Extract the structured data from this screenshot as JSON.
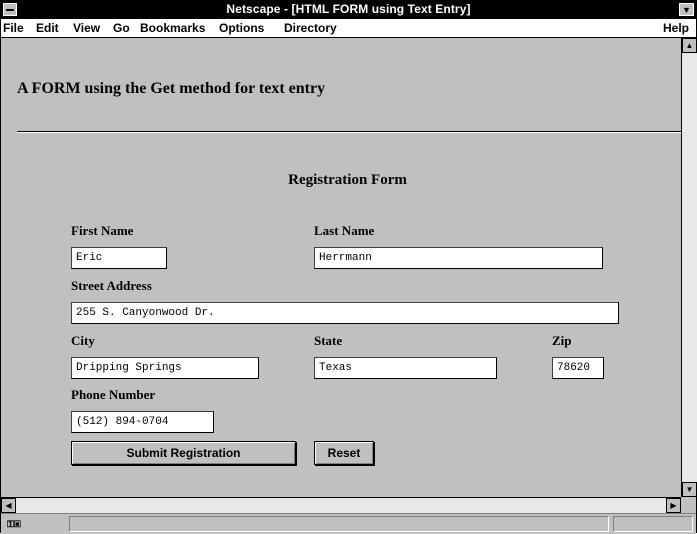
{
  "window": {
    "title": "Netscape - [HTML FORM using Text Entry]"
  },
  "menu": {
    "items": [
      {
        "label": "File"
      },
      {
        "label": "Edit"
      },
      {
        "label": "View"
      },
      {
        "label": "Go"
      },
      {
        "label": "Bookmarks"
      },
      {
        "label": "Options"
      },
      {
        "label": "Directory"
      },
      {
        "label": "Help"
      }
    ]
  },
  "page": {
    "heading": "A FORM using the Get method for text entry",
    "form_title": "Registration Form"
  },
  "form": {
    "first_name": {
      "label": "First Name",
      "value": "Eric"
    },
    "last_name": {
      "label": "Last Name",
      "value": "Herrmann"
    },
    "street": {
      "label": "Street Address",
      "value": "255 S. Canyonwood Dr."
    },
    "city": {
      "label": "City",
      "value": "Dripping Springs"
    },
    "state": {
      "label": "State",
      "value": "Texas"
    },
    "zip": {
      "label": "Zip",
      "value": "78620"
    },
    "phone": {
      "label": "Phone Number",
      "value": "(512) 894-0704"
    },
    "submit_label": "Submit Registration",
    "reset_label": "Reset"
  },
  "icons": {
    "system_menu": "system-menu-icon",
    "minimize": "minimize-icon",
    "security_key": "security-key-icon"
  },
  "colors": {
    "window_bg": "#c0c0c0",
    "titlebar": "#000000",
    "field_bg": "#ffffff"
  }
}
